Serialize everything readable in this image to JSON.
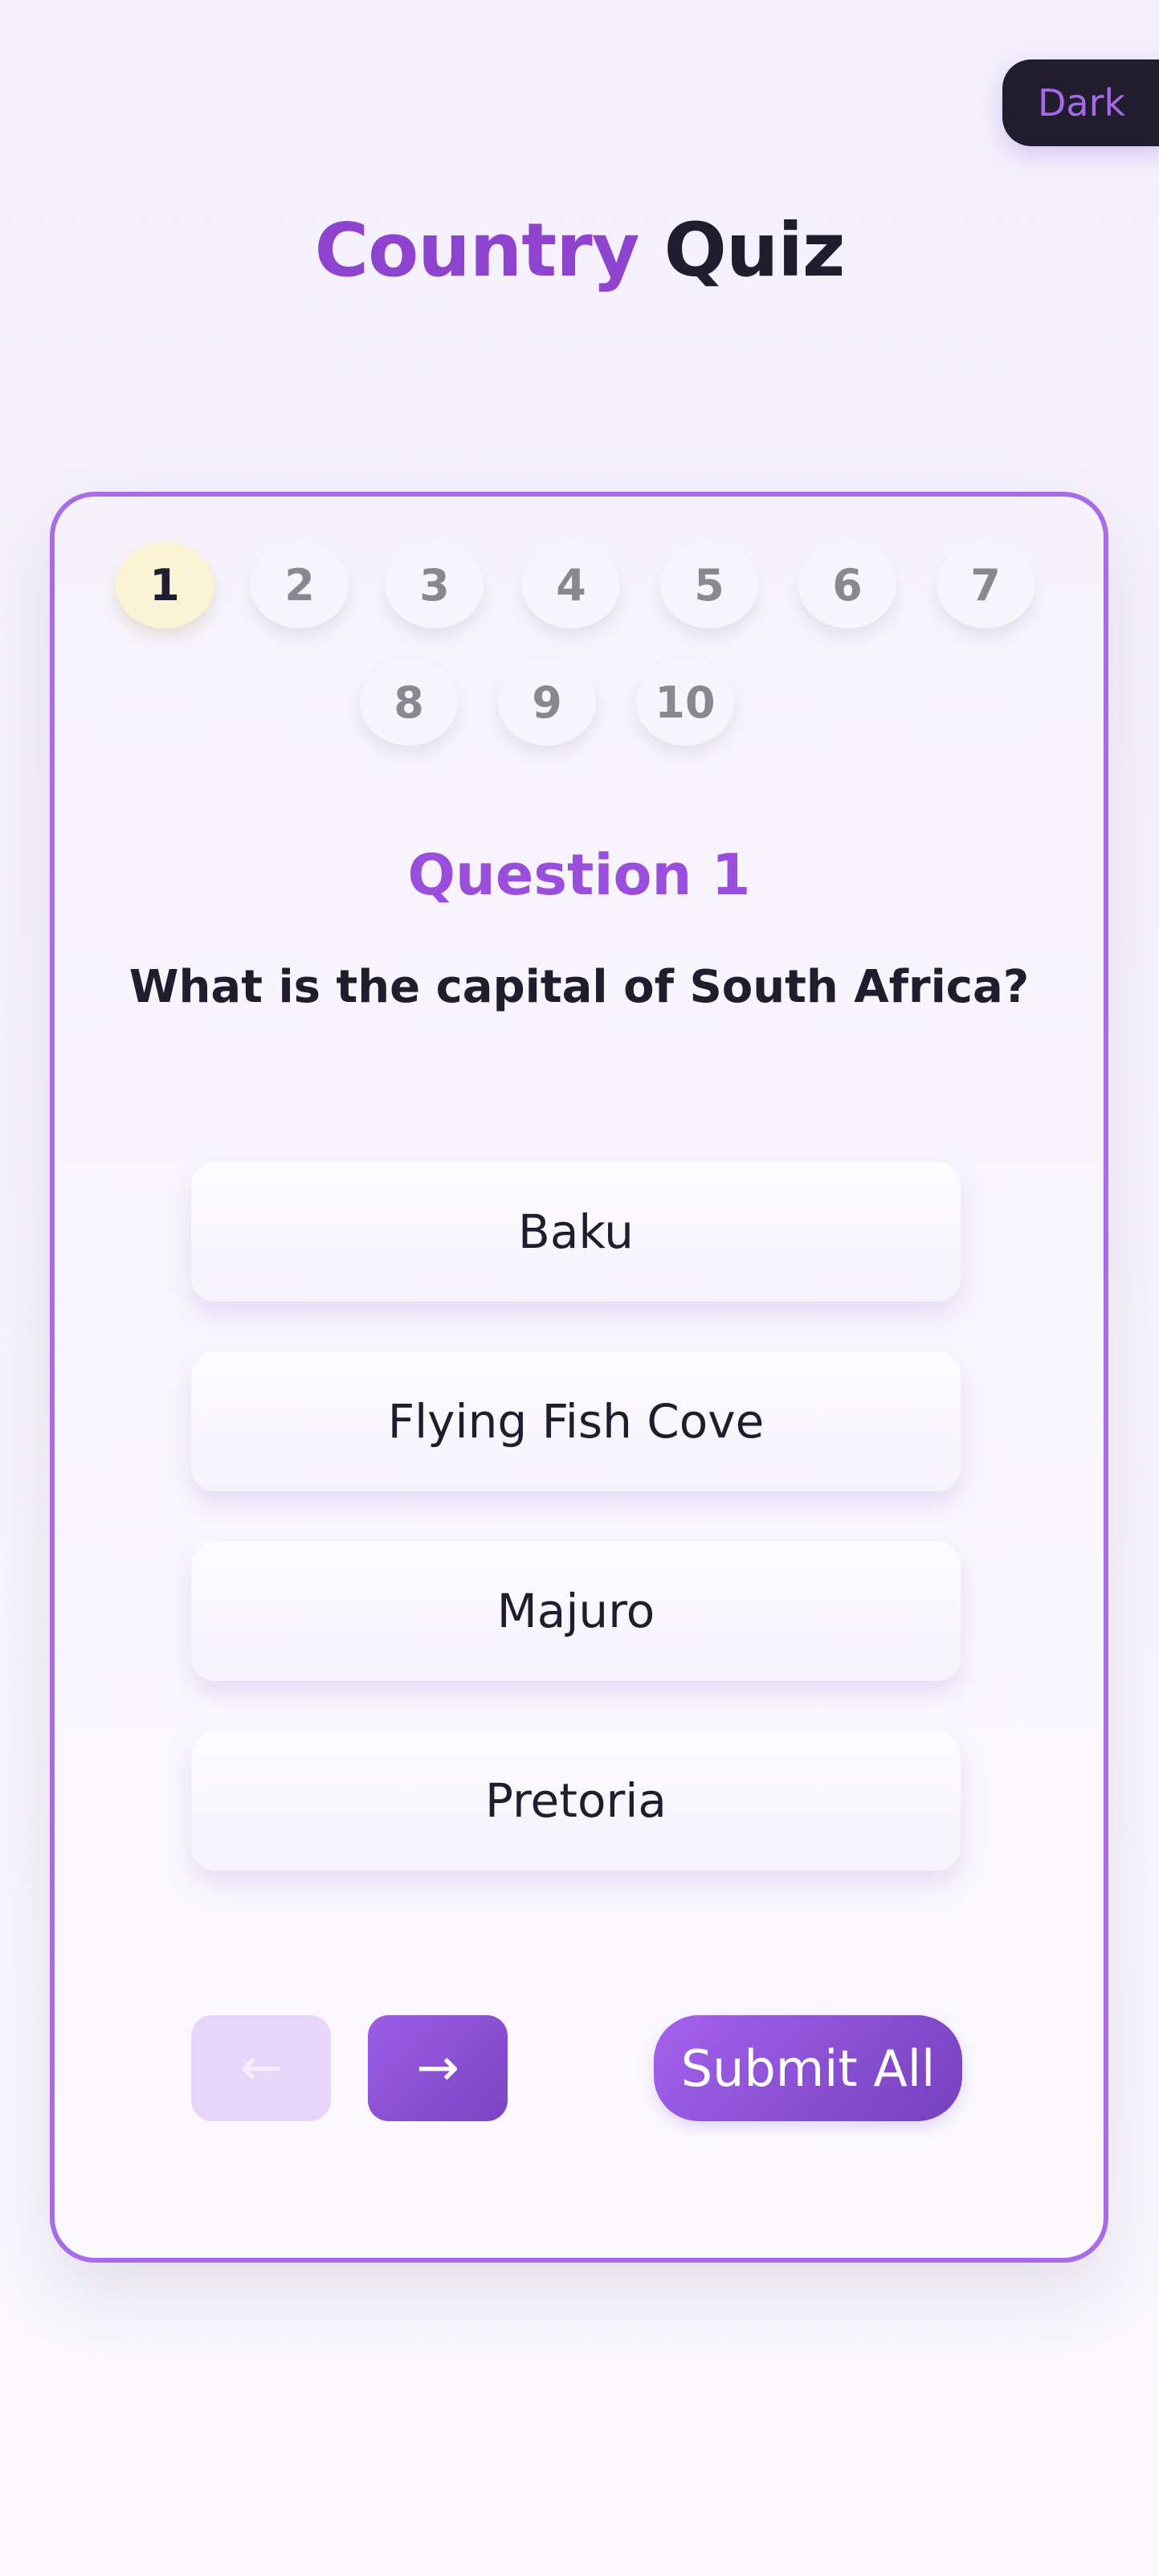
{
  "theme_toggle": {
    "label": "Dark"
  },
  "title": {
    "accent": "Country",
    "rest": " Quiz"
  },
  "question_nav": [
    "1",
    "2",
    "3",
    "4",
    "5",
    "6",
    "7",
    "8",
    "9",
    "10"
  ],
  "question": {
    "number_label": "Question 1",
    "text": "What is the capital of South Africa?"
  },
  "options": [
    "Baku",
    "Flying Fish Cove",
    "Majuro",
    "Pretoria"
  ],
  "buttons": {
    "prev_icon": "←",
    "next_icon": "→",
    "submit_label": "Submit All"
  },
  "colors": {
    "accent": "#8e44cf",
    "active_question_bg": "#fbf3d5",
    "card_border": "#a96ce8",
    "toggle_bg": "#1f1d2e"
  }
}
